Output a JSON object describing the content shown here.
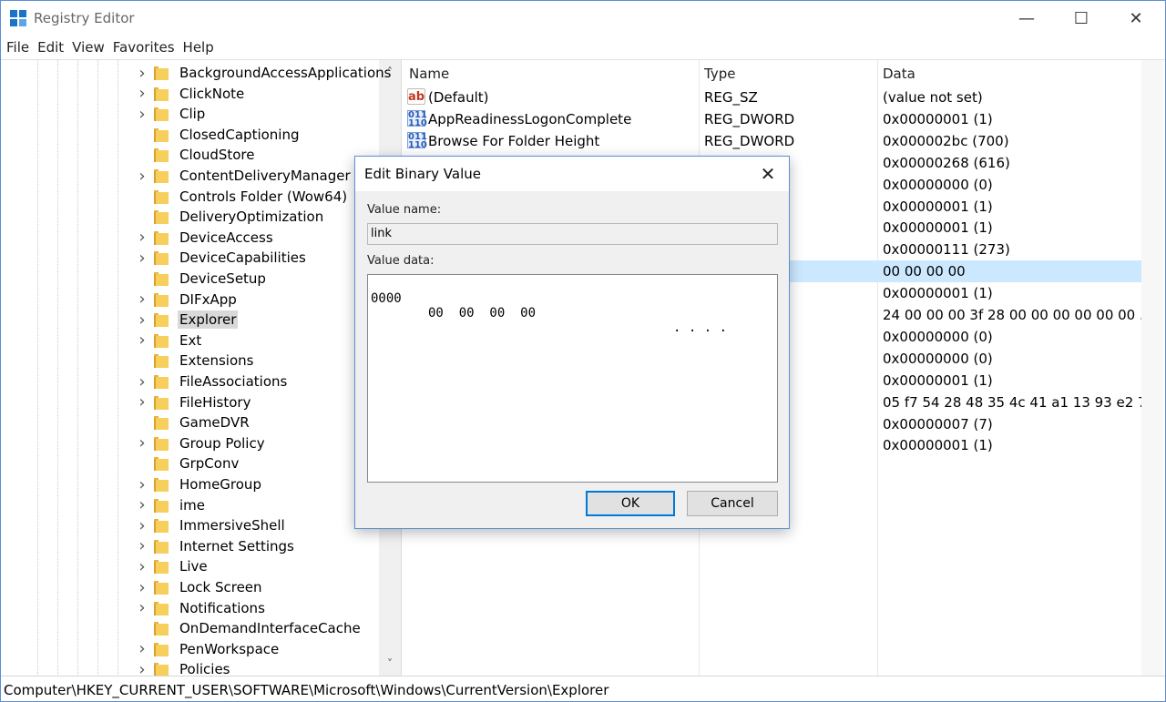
{
  "window": {
    "title": "Registry Editor"
  },
  "menu": [
    "File",
    "Edit",
    "View",
    "Favorites",
    "Help"
  ],
  "tree": {
    "items": [
      {
        "label": "BackgroundAccessApplications",
        "expandable": true
      },
      {
        "label": "ClickNote",
        "expandable": true
      },
      {
        "label": "Clip",
        "expandable": true
      },
      {
        "label": "ClosedCaptioning",
        "expandable": false
      },
      {
        "label": "CloudStore",
        "expandable": false
      },
      {
        "label": "ContentDeliveryManager",
        "expandable": true
      },
      {
        "label": "Controls Folder (Wow64)",
        "expandable": false
      },
      {
        "label": "DeliveryOptimization",
        "expandable": false
      },
      {
        "label": "DeviceAccess",
        "expandable": true
      },
      {
        "label": "DeviceCapabilities",
        "expandable": true
      },
      {
        "label": "DeviceSetup",
        "expandable": false
      },
      {
        "label": "DIFxApp",
        "expandable": true
      },
      {
        "label": "Explorer",
        "expandable": true,
        "selected": true
      },
      {
        "label": "Ext",
        "expandable": true
      },
      {
        "label": "Extensions",
        "expandable": false
      },
      {
        "label": "FileAssociations",
        "expandable": true
      },
      {
        "label": "FileHistory",
        "expandable": true
      },
      {
        "label": "GameDVR",
        "expandable": false
      },
      {
        "label": "Group Policy",
        "expandable": true
      },
      {
        "label": "GrpConv",
        "expandable": false
      },
      {
        "label": "HomeGroup",
        "expandable": true
      },
      {
        "label": "ime",
        "expandable": true
      },
      {
        "label": "ImmersiveShell",
        "expandable": true
      },
      {
        "label": "Internet Settings",
        "expandable": true
      },
      {
        "label": "Live",
        "expandable": true
      },
      {
        "label": "Lock Screen",
        "expandable": true
      },
      {
        "label": "Notifications",
        "expandable": true
      },
      {
        "label": "OnDemandInterfaceCache",
        "expandable": false
      },
      {
        "label": "PenWorkspace",
        "expandable": true
      },
      {
        "label": "Policies",
        "expandable": true
      }
    ]
  },
  "list": {
    "columns": [
      "Name",
      "Type",
      "Data"
    ],
    "rows": [
      {
        "icon": "string-value-icon",
        "name": "(Default)",
        "type": "REG_SZ",
        "data": "(value not set)"
      },
      {
        "icon": "dword-value-icon",
        "name": "AppReadinessLogonComplete",
        "type": "REG_DWORD",
        "data": "0x00000001 (1)"
      },
      {
        "icon": "dword-value-icon",
        "name": "Browse For Folder Height",
        "type": "REG_DWORD",
        "data": "0x000002bc (700)"
      },
      {
        "icon": "",
        "name": "",
        "type": "",
        "data": "0x00000268 (616)"
      },
      {
        "icon": "",
        "name": "",
        "type": "",
        "data": "0x00000000 (0)"
      },
      {
        "icon": "",
        "name": "",
        "type": "",
        "data": "0x00000001 (1)"
      },
      {
        "icon": "",
        "name": "",
        "type": "",
        "data": "0x00000001 (1)"
      },
      {
        "icon": "",
        "name": "",
        "type": "",
        "data": "0x00000111 (273)"
      },
      {
        "icon": "",
        "name": "",
        "type": "",
        "data": "00 00 00 00",
        "selected": true
      },
      {
        "icon": "",
        "name": "",
        "type": "",
        "data": "0x00000001 (1)"
      },
      {
        "icon": "",
        "name": "",
        "type": "",
        "data": "24 00 00 00 3f 28 00 00 00 00 00 00 ..."
      },
      {
        "icon": "",
        "name": "",
        "type": "",
        "data": "0x00000000 (0)"
      },
      {
        "icon": "",
        "name": "",
        "type": "",
        "data": "0x00000000 (0)"
      },
      {
        "icon": "",
        "name": "",
        "type": "",
        "data": "0x00000001 (1)"
      },
      {
        "icon": "",
        "name": "",
        "type": "",
        "data": "05 f7 54 28 48 35 4c 41 a1 13 93 e2 7..."
      },
      {
        "icon": "",
        "name": "",
        "type": "",
        "data": "0x00000007 (7)"
      },
      {
        "icon": "",
        "name": "",
        "type": "",
        "data": "0x00000001 (1)"
      }
    ]
  },
  "status": {
    "path": "Computer\\HKEY_CURRENT_USER\\SOFTWARE\\Microsoft\\Windows\\CurrentVersion\\Explorer"
  },
  "dialog": {
    "title": "Edit Binary Value",
    "value_name_label": "Value name:",
    "value_name": "link",
    "value_data_label": "Value data:",
    "hex": {
      "address": "0000",
      "bytes": "00  00  00  00",
      "ascii": ". . . ."
    },
    "ok_label": "OK",
    "cancel_label": "Cancel"
  },
  "colors": {
    "selection": "#cce8ff",
    "accent": "#0078d7",
    "window_border": "#5b8fd6"
  }
}
